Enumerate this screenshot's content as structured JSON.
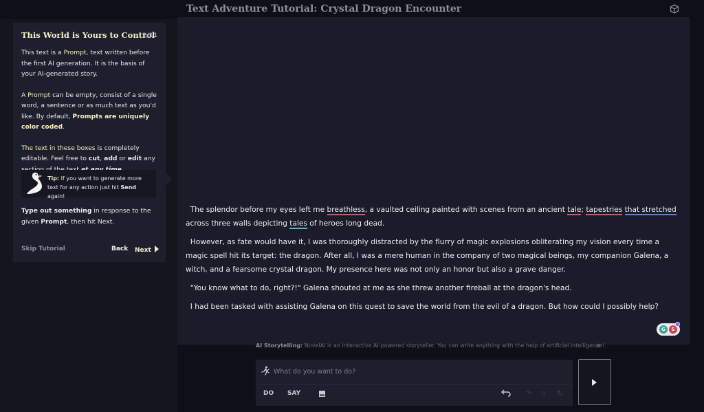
{
  "header": {
    "title": "Text Adventure Tutorial: Crystal Dragon Encounter",
    "icon": "dice-icon"
  },
  "tutorial": {
    "title": "This World is Yours to Control",
    "step": "2/11",
    "p1": {
      "a": "This text is a ",
      "b": "Prompt",
      "c": ", text written before the first AI generation. It is the basis of your AI-generated story."
    },
    "p2": {
      "a": "A ",
      "b": "Prompt",
      "c": " can be empty, consist of a single word, a sentence or as much text as you'd like. By default, ",
      "d": "Prompts are uniquely color coded",
      "e": "."
    },
    "p3": {
      "a": "The text in these boxes",
      "b": " is completely editable. Feel free to ",
      "c": "cut",
      "d": ", ",
      "e": "add",
      "f": " or ",
      "g": "edit",
      "h": " any section of the text ",
      "i": "at any time",
      "j": "."
    },
    "tip": {
      "label": "Tip:",
      "a": " If you want to generate more text for any action just hit ",
      "b": "Send",
      "c": " again!"
    },
    "instruction": {
      "a": "Type out something",
      "b": " in response to the given ",
      "c": "Prompt",
      "d": ", then hit Next."
    },
    "skip_label": "Skip Tutorial",
    "back_label": "Back",
    "next_label": "Next"
  },
  "story": {
    "p1": {
      "a": "The splendor before my eyes left me ",
      "b": "breathless",
      "c": ", a vaulted ceiling painted with scenes from an ancient ",
      "d": "tale",
      "e": "; ",
      "f": "tapestries",
      "g": " ",
      "h": "that stretched",
      "i": " across three walls depicting ",
      "j": "tales",
      "k": " of heroes long dead."
    },
    "p2": "However, as fate would have it, I was thoroughly distracted by the flurry of magic explosions obliterating my vision every time a magic spell hit its target: the dragon. After all, I was a mere human in the company of two magical beings, my companion Galena, a witch, and a fearsome crystal dragon. My presence here was not only an honor but also a grave danger.",
    "p3": "\"You know what to do, right?!\" Galena shouted at me as she threw another fireball at the dragon's head.",
    "p4": "I had been tasked with assisting Galena on this quest to save the world from the evil of a dragon. But how could I possibly help?"
  },
  "badges": {
    "g": "G",
    "s": "S"
  },
  "hint": {
    "label": "AI Storytelling:",
    "text": " NovelAI is an interactive AI-powered storyteller. You can write anything with the help of artificial intelligence!..."
  },
  "input": {
    "placeholder": "What do you want to do?",
    "do_label": "DO",
    "say_label": "SAY",
    "count": "0"
  },
  "colors": {
    "accent": "#f5eec3",
    "background": "#0f1017",
    "panel": "#1e1f2c",
    "story_bg": "#1b1c2a"
  }
}
